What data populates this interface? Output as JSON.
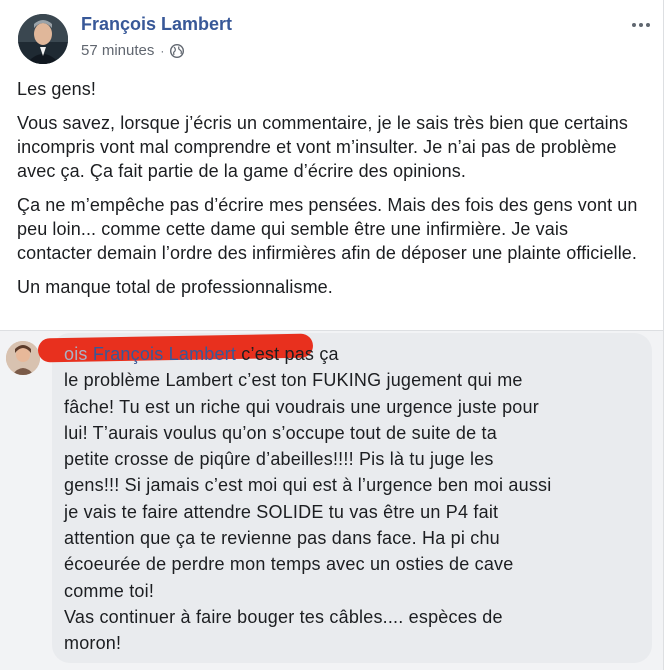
{
  "post": {
    "author": "François Lambert",
    "timestamp": "57 minutes",
    "separator": "·",
    "paragraphs": [
      "Les gens!",
      "Vous savez, lorsque j’écris un commentaire, je le sais très bien que certains incompris vont mal comprendre et vont m’insulter. Je n’ai pas de problème avec ça. Ça fait partie de la game d’écrire des opinions.",
      "Ça ne m’empêche pas d’écrire mes pensées. Mais des fois des gens vont un peu loin... comme cette dame qui semble être une infirmière. Je vais contacter demain l’ordre des infirmières afin de déposer une plainte officielle.",
      "Un manque total de professionnalisme."
    ]
  },
  "comment": {
    "commenter_fragment": "ois",
    "mention": "François Lambert",
    "lines": [
      " c’est pas ça",
      "le problème Lambert c’est ton FUKING jugement qui me",
      "fâche! Tu est un riche qui voudrais une urgence juste pour",
      "lui! T’aurais voulus qu’on s’occupe tout de suite de ta",
      "petite crosse de piqûre d’abeilles!!!! Pis là tu juge les",
      "gens!!! Si jamais c’est moi qui est à l’urgence ben moi aussi",
      "je vais te faire attendre SOLIDE tu vas être un P4 fait",
      "attention que ça te revienne pas dans face. Ha pi chu",
      "écoeurée de perdre mon temps avec un osties de cave",
      "comme toi!",
      "Vas continuer à faire bouger tes câbles.... espèces de",
      "moron!"
    ]
  },
  "icons": {
    "globe": "globe-icon",
    "more": "more-options-icon"
  },
  "colors": {
    "name_link": "#385898",
    "meta_text": "#616770",
    "comment_bubble": "#e9ebee",
    "redaction": "#e8301e"
  }
}
